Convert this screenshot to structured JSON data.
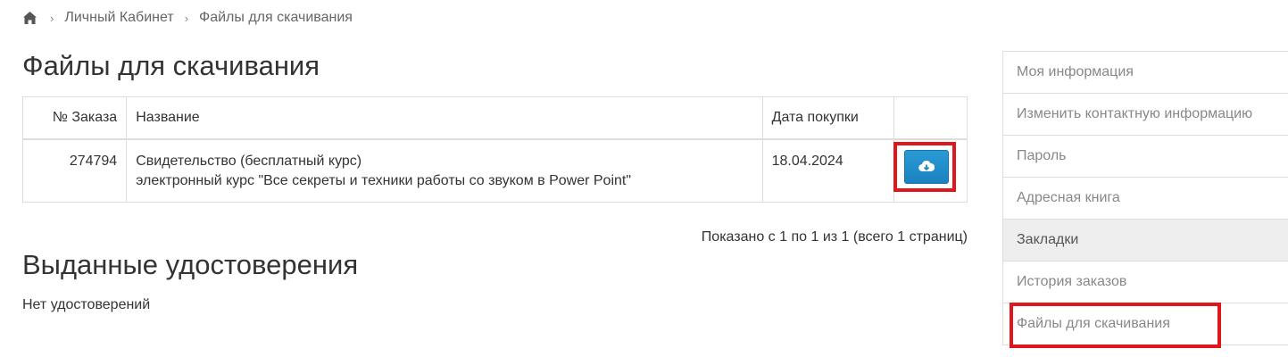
{
  "breadcrumb": {
    "items": [
      "Личный Кабинет",
      "Файлы для скачивания"
    ]
  },
  "page_title": "Файлы для скачивания",
  "table": {
    "headers": [
      "№ Заказа",
      "Название",
      "Дата покупки",
      ""
    ],
    "rows": [
      {
        "order": "274794",
        "name_line1": "Свидетельство (бесплатный курс)",
        "name_line2": "электронный курс \"Все секреты и техники работы со звуком в Power Point\"",
        "date": "18.04.2024",
        "action_icon": "cloud-download-icon"
      }
    ]
  },
  "pagination_info": "Показано с 1 по 1 из 1 (всего 1 страниц)",
  "certificates": {
    "title": "Выданные удостоверения",
    "empty_text": "Нет удостоверений"
  },
  "sidebar": {
    "items": [
      {
        "label": "Моя информация"
      },
      {
        "label": "Изменить контактную информацию"
      },
      {
        "label": "Пароль"
      },
      {
        "label": "Адресная книга"
      },
      {
        "label": "Закладки"
      },
      {
        "label": "История заказов"
      },
      {
        "label": "Файлы для скачивания"
      }
    ],
    "active_index": 4
  },
  "colors": {
    "button": "#1f8ac9",
    "highlight": "#e0161d",
    "active_bg": "#eeeeee"
  }
}
